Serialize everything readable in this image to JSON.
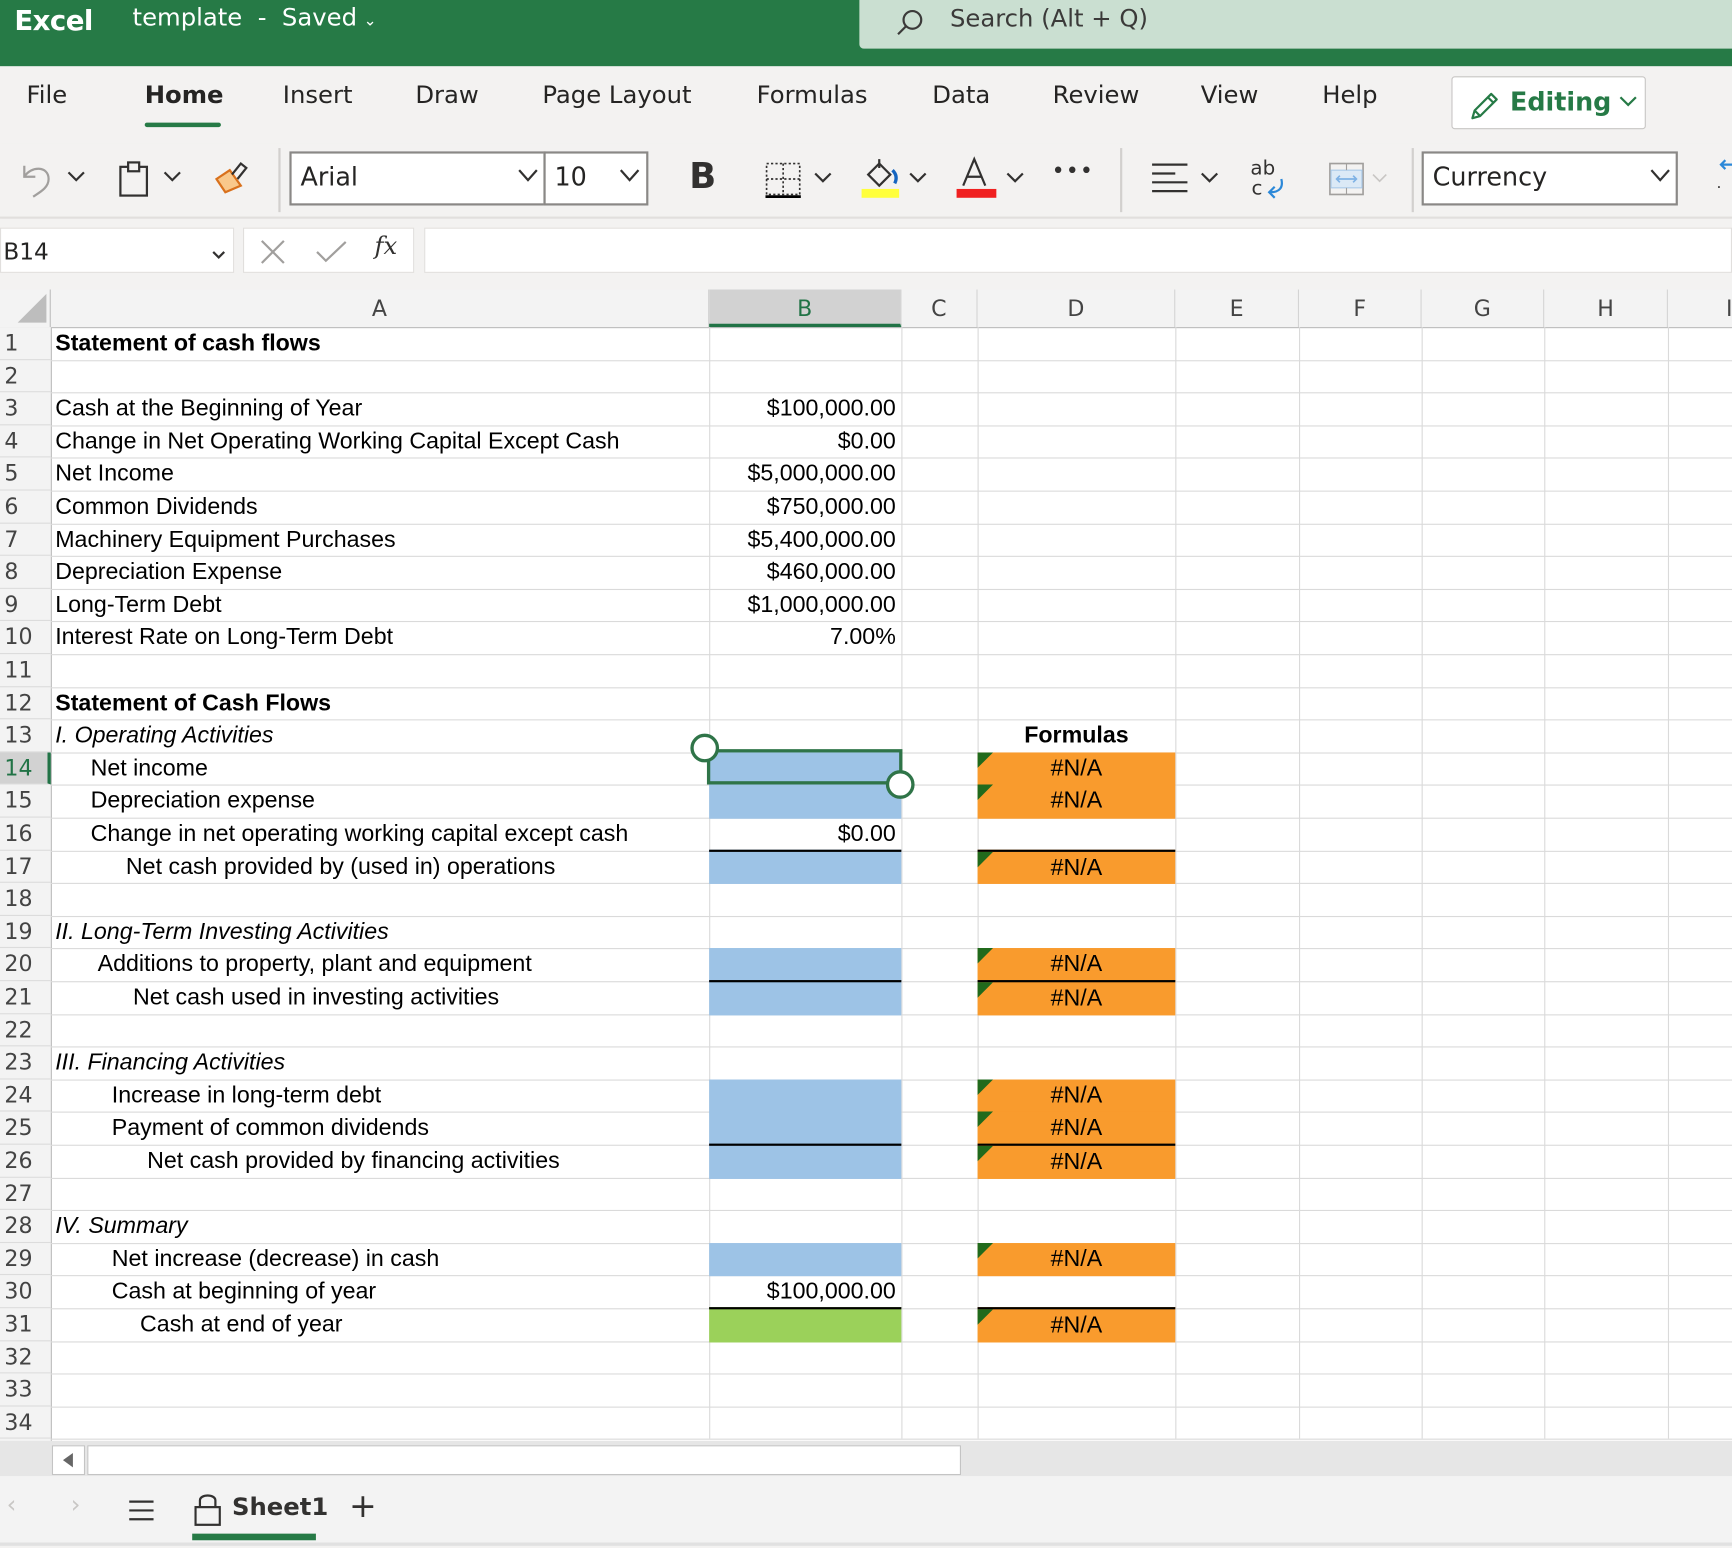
{
  "titlebar": {
    "app_name": "Excel",
    "document_title": "template  -  Saved",
    "search_placeholder": "Search (Alt + Q)",
    "brand_color": "#267a46"
  },
  "ribbon": {
    "tabs": [
      {
        "label": "File",
        "active": false
      },
      {
        "label": "Home",
        "active": true
      },
      {
        "label": "Insert",
        "active": false
      },
      {
        "label": "Draw",
        "active": false
      },
      {
        "label": "Page Layout",
        "active": false
      },
      {
        "label": "Formulas",
        "active": false
      },
      {
        "label": "Data",
        "active": false
      },
      {
        "label": "Review",
        "active": false
      },
      {
        "label": "View",
        "active": false
      },
      {
        "label": "Help",
        "active": false
      }
    ],
    "mode_button": "Editing"
  },
  "toolbar": {
    "font_name": "Arial",
    "font_size": "10",
    "bold_label": "B",
    "number_format": "Currency",
    "fill_color": "#ffff3c",
    "font_color": "#f02020",
    "more_label": "•••",
    "wrap_label": "ab"
  },
  "formula_bar": {
    "name_box": "B14",
    "fx_label": "fx",
    "formula": ""
  },
  "sheet": {
    "columns": [
      "A",
      "B",
      "C",
      "D",
      "E",
      "F",
      "G",
      "H",
      "I"
    ],
    "selected_column": "B",
    "selected_row": 14,
    "rows": [
      {
        "n": 1,
        "a": "Statement of cash flows",
        "a_style": "bold"
      },
      {
        "n": 2
      },
      {
        "n": 3,
        "a": "Cash at the Beginning of Year",
        "b": "$100,000.00"
      },
      {
        "n": 4,
        "a": "Change in Net Operating Working Capital Except Cash",
        "b": "$0.00"
      },
      {
        "n": 5,
        "a": "Net Income",
        "b": "$5,000,000.00"
      },
      {
        "n": 6,
        "a": "Common Dividends",
        "b": "$750,000.00"
      },
      {
        "n": 7,
        "a": "Machinery Equipment Purchases",
        "b": "$5,400,000.00"
      },
      {
        "n": 8,
        "a": "Depreciation Expense",
        "b": "$460,000.00"
      },
      {
        "n": 9,
        "a": "Long-Term Debt",
        "b": "$1,000,000.00"
      },
      {
        "n": 10,
        "a": "Interest Rate on Long-Term Debt",
        "b": "7.00%"
      },
      {
        "n": 11
      },
      {
        "n": 12,
        "a": "Statement of Cash Flows",
        "a_style": "bold"
      },
      {
        "n": 13,
        "a": "I.  Operating Activities",
        "a_style": "italic",
        "d": "Formulas",
        "d_style": "bold"
      },
      {
        "n": 14,
        "a": "Net income",
        "indent": 1,
        "b_fill": "blue",
        "d": "#N/A",
        "d_fill": "orange"
      },
      {
        "n": 15,
        "a": "Depreciation expense",
        "indent": 1,
        "b_fill": "blue",
        "d": "#N/A",
        "d_fill": "orange"
      },
      {
        "n": 16,
        "a": "Change in net operating working capital except cash",
        "indent": 1,
        "b": "$0.00"
      },
      {
        "n": 17,
        "a": "Net cash provided by (used in) operations",
        "indent": 2,
        "b_fill": "blue",
        "b_top": true,
        "d": "#N/A",
        "d_fill": "orange",
        "d_top": true
      },
      {
        "n": 18
      },
      {
        "n": 19,
        "a": "II.  Long-Term Investing Activities",
        "a_style": "italic"
      },
      {
        "n": 20,
        "a": "Additions to property, plant and equipment",
        "indent": 1.2,
        "b_fill": "blue",
        "d": "#N/A",
        "d_fill": "orange"
      },
      {
        "n": 21,
        "a": "Net cash used in investing activities",
        "indent": 2.2,
        "b_fill": "blue",
        "b_top": true,
        "d": "#N/A",
        "d_fill": "orange",
        "d_top": true
      },
      {
        "n": 22
      },
      {
        "n": 23,
        "a": "III.  Financing Activities",
        "a_style": "italic"
      },
      {
        "n": 24,
        "a": "Increase in long-term debt",
        "indent": 1.6,
        "b_fill": "blue",
        "d": "#N/A",
        "d_fill": "orange"
      },
      {
        "n": 25,
        "a": "Payment of common dividends",
        "indent": 1.6,
        "b_fill": "blue",
        "d": "#N/A",
        "d_fill": "orange"
      },
      {
        "n": 26,
        "a": "Net cash provided by financing activities",
        "indent": 2.6,
        "b_fill": "blue",
        "b_top": true,
        "d": "#N/A",
        "d_fill": "orange",
        "d_top": true
      },
      {
        "n": 27
      },
      {
        "n": 28,
        "a": "IV.  Summary",
        "a_style": "italic"
      },
      {
        "n": 29,
        "a": "Net increase (decrease) in cash",
        "indent": 1.6,
        "b_fill": "blue",
        "d": "#N/A",
        "d_fill": "orange"
      },
      {
        "n": 30,
        "a": "Cash at beginning of year",
        "indent": 1.6,
        "b": "$100,000.00"
      },
      {
        "n": 31,
        "a": "Cash at end of year",
        "indent": 2.4,
        "b_fill": "green",
        "b_top": true,
        "d": "#N/A",
        "d_fill": "orange",
        "d_top": true
      },
      {
        "n": 32
      },
      {
        "n": 33
      },
      {
        "n": 34
      }
    ]
  },
  "sheet_tabs": {
    "tabs": [
      {
        "label": "Sheet1",
        "active": true,
        "locked": true
      }
    ],
    "add_label": "+"
  }
}
